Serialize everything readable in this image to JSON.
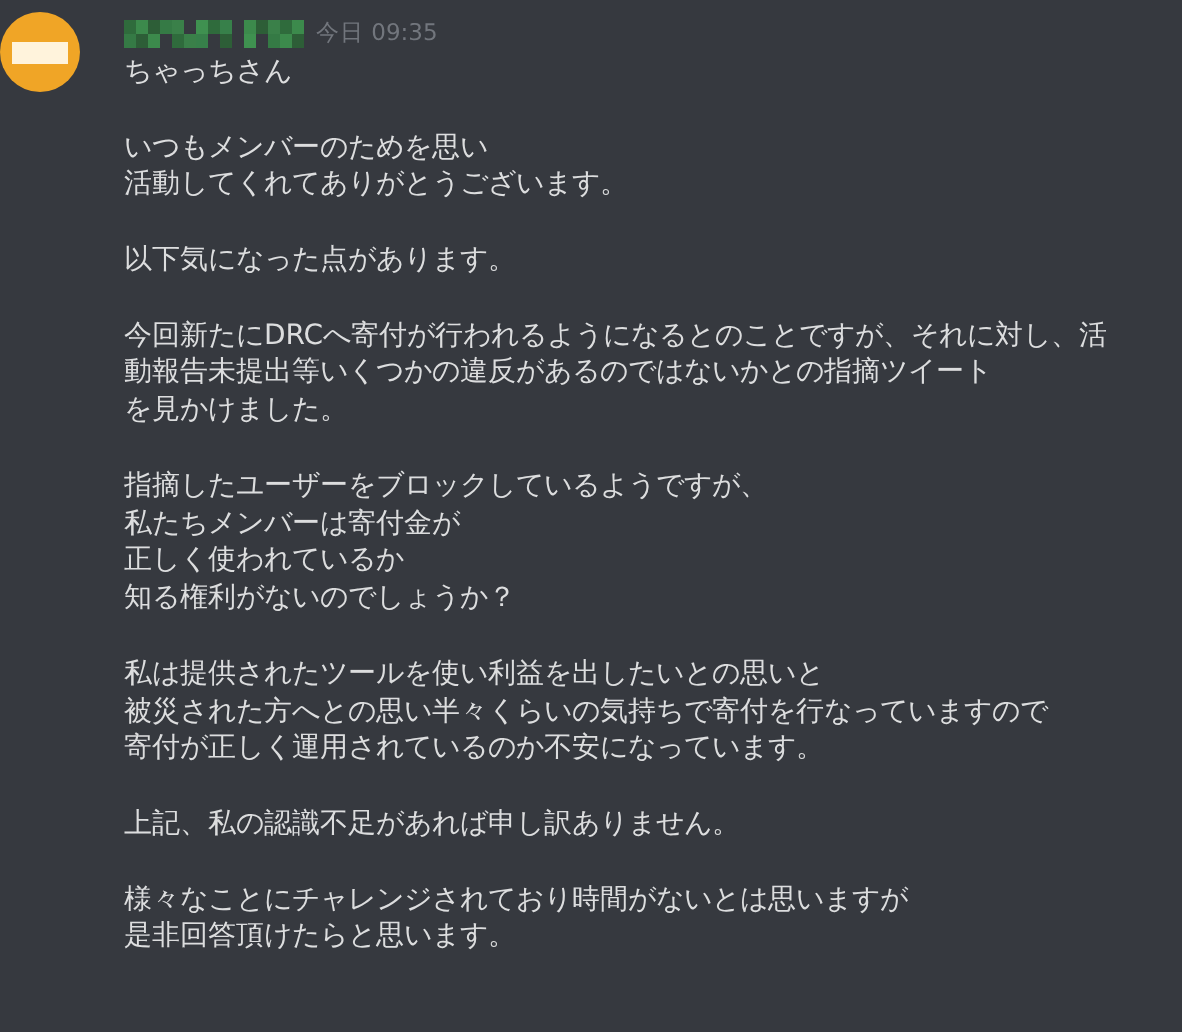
{
  "message": {
    "timestamp": "今日 09:35",
    "paragraphs": [
      {
        "kind": "normal",
        "lines": [
          "ちゃっちさん"
        ]
      },
      {
        "kind": "normal",
        "lines": [
          "いつもメンバーのためを思い",
          "活動してくれてありがとうございます。"
        ]
      },
      {
        "kind": "normal",
        "lines": [
          "以下気になった点があります。"
        ]
      },
      {
        "kind": "normal",
        "lines": [
          "今回新たにDRCへ寄付が行われるようになるとのことですが、それに対し、活",
          "動報告未提出等いくつかの違反があるのではないかとの指摘ツイート",
          "を見かけました。"
        ]
      },
      {
        "kind": "normal",
        "lines": [
          "指摘したユーザーをブロックしているようですが、",
          "私たちメンバーは寄付金が",
          "正しく使われているか",
          "知る権利がないのでしょうか？"
        ]
      },
      {
        "kind": "normal",
        "lines": [
          "私は提供されたツールを使い利益を出したいとの思いと",
          "被災された方へとの思い半々くらいの気持ちで寄付を行なっていますので",
          "寄付が正しく運用されているのか不安になっています。"
        ]
      },
      {
        "kind": "normal",
        "lines": [
          "上記、私の認識不足があれば申し訳ありません。"
        ]
      },
      {
        "kind": "spaced",
        "lines": [
          "様々なことにチャレンジされており時間がないとは思いますが",
          "是非回答頂けたらと思います。"
        ]
      }
    ]
  }
}
